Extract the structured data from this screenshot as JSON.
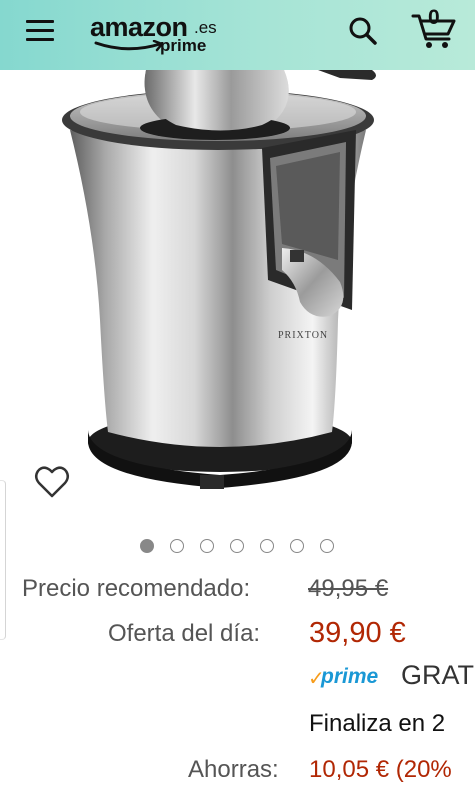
{
  "header": {
    "logo_word": "amazon",
    "logo_tld": ".es",
    "logo_sub": "prime",
    "cart_count": "0"
  },
  "product": {
    "brand_mark": "PRIXTON",
    "image_count": 7,
    "active_image": 0
  },
  "pricing": {
    "list_price_label": "Precio recomendado:",
    "list_price": "49,95 €",
    "deal_label": "Oferta del día:",
    "deal_price": "39,90 €",
    "prime_label": "prime",
    "shipping_text": "GRAT",
    "ends_text": "Finaliza en 2",
    "savings_label": "Ahorras:",
    "savings_value": "10,05 € (20%"
  },
  "colors": {
    "header_gradient_start": "#85d8cf",
    "header_gradient_end": "#b8ead9",
    "price_red": "#B12704",
    "prime_blue": "#1a98d5",
    "prime_check": "#f79c1b"
  },
  "icons": {
    "menu": "hamburger-menu-icon",
    "search": "search-icon",
    "cart": "cart-icon",
    "wishlist": "heart-outline-icon"
  }
}
